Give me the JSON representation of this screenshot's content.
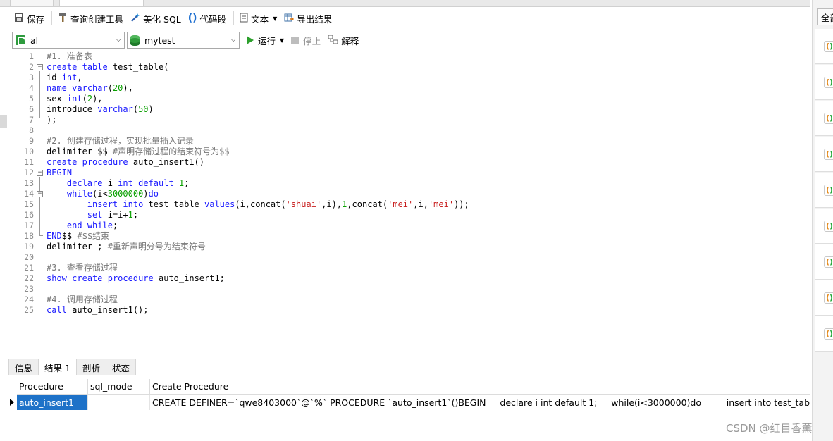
{
  "toolbar": {
    "save": "保存",
    "query_builder": "查询创建工具",
    "beautify": "美化 SQL",
    "snippet": "代码段",
    "text": "文本",
    "export": "导出结果"
  },
  "selectors": {
    "connection": "al",
    "database": "mytest",
    "run": "运行",
    "stop": "停止",
    "explain": "解释"
  },
  "editor": {
    "line_numbers": [
      "1",
      "2",
      "3",
      "4",
      "5",
      "6",
      "7",
      "8",
      "9",
      "10",
      "11",
      "12",
      "13",
      "14",
      "15",
      "16",
      "17",
      "18",
      "19",
      "20",
      "21",
      "22",
      "23",
      "24",
      "25"
    ],
    "lines": [
      "#1. 准备表",
      "create table test_table(",
      "id int,",
      "name varchar(20),",
      "sex int(2),",
      "introduce varchar(50)",
      ");",
      "",
      "#2. 创建存储过程，实现批量插入记录",
      "delimiter $$ #声明存储过程的结束符号为$$",
      "create procedure auto_insert1()",
      "BEGIN",
      "    declare i int default 1;",
      "    while(i<3000000)do",
      "        insert into test_table values(i,concat('shuai',i),1,concat('mei',i,'mei'));",
      "        set i=i+1;",
      "    end while;",
      "END$$ #$$结束",
      "delimiter ; #重新声明分号为结束符号",
      "",
      "#3. 查看存储过程",
      "show create procedure auto_insert1;",
      "",
      "#4. 调用存储过程",
      "call auto_insert1();"
    ]
  },
  "results": {
    "tabs": [
      "信息",
      "结果 1",
      "剖析",
      "状态"
    ],
    "active_tab": "结果 1",
    "columns": [
      "Procedure",
      "sql_mode",
      "Create Procedure"
    ],
    "rows": [
      {
        "procedure": "auto_insert1",
        "sql_mode": "",
        "create_procedure": "CREATE DEFINER=`qwe8403000`@`%` PROCEDURE `auto_insert1`()BEGIN     declare i int default 1;     while(i<3000000)do         insert into test_table values(i,concat"
      }
    ]
  },
  "right_panel": {
    "button_label": "全部"
  },
  "watermark": "CSDN @红目香薰",
  "colors": {
    "keyword": "#1a1aff",
    "comment": "#777777",
    "number": "#0aa000",
    "string": "#c81e1e",
    "selection": "#1e72c8",
    "run_icon": "#2ca02c"
  }
}
